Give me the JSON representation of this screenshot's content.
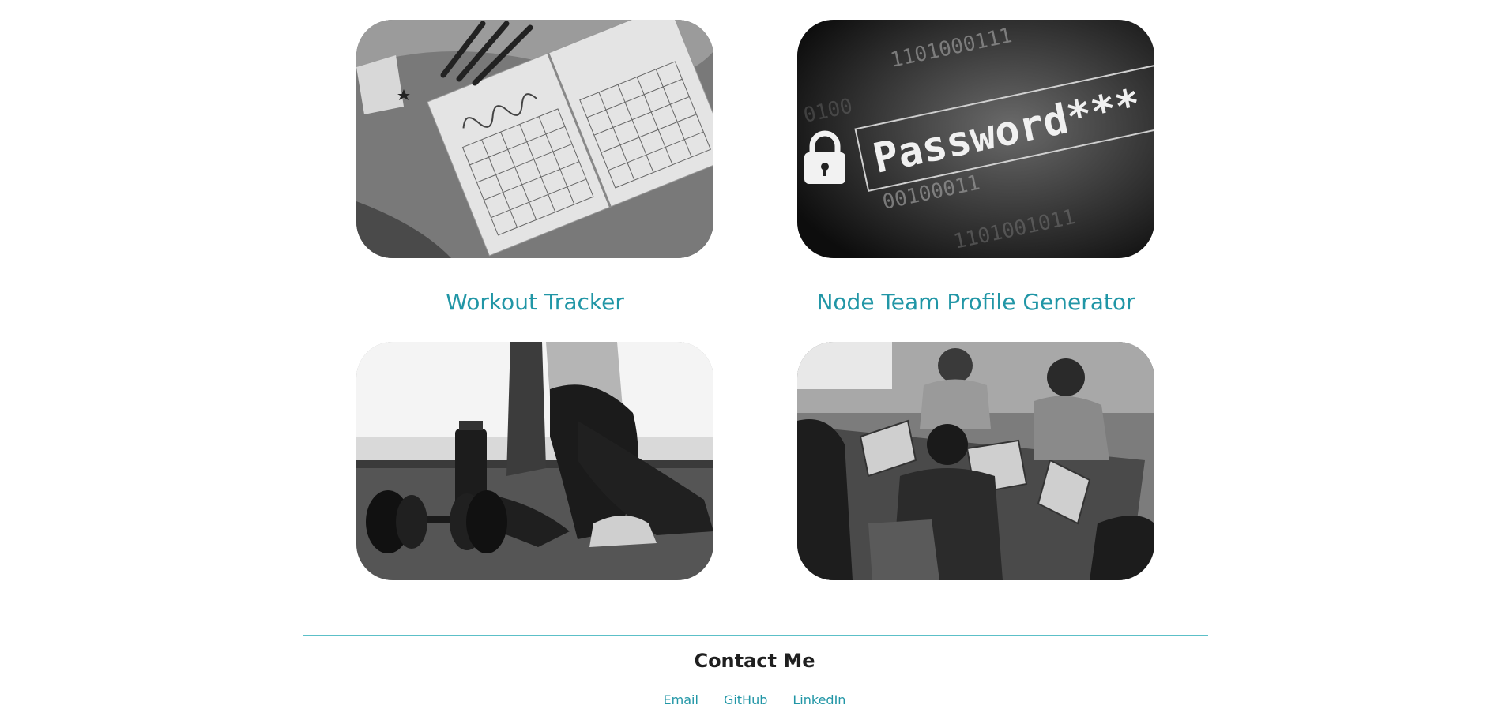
{
  "projects": [
    {
      "image": "calendar-planner-photo",
      "title": ""
    },
    {
      "image": "password-security-photo",
      "title": ""
    },
    {
      "image": "workout-dumbbell-photo",
      "title": "Workout Tracker"
    },
    {
      "image": "team-laptops-photo",
      "title": "Node Team Profile Generator"
    }
  ],
  "password_image_text": "Password***",
  "footer": {
    "heading": "Contact Me",
    "links": [
      "Email",
      "GitHub",
      "LinkedIn"
    ]
  },
  "colors": {
    "accent": "#2196a6",
    "divider": "#5cc0c8",
    "heading": "#1f1f1f"
  }
}
